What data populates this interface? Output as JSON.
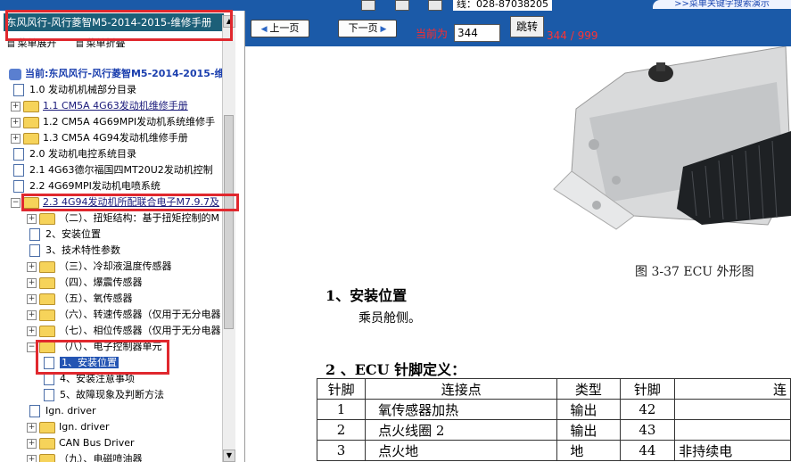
{
  "top": {
    "phone_text": "线：028-87038205",
    "link_text": ">>菜单关键字搜索演示"
  },
  "left": {
    "title": "东风风行-风行菱智M5-2014-2015-维修手册",
    "menu_expand": "菜单展开",
    "menu_collapse": "菜单折叠",
    "tree": [
      {
        "label": "当前:东风风行-风行菱智M5-2014-2015-维修",
        "kind": "root",
        "depth": 0
      },
      {
        "label": "1.0 发动机机械部分目录",
        "kind": "doc",
        "depth": 1
      },
      {
        "label": "1.1 CM5A 4G63发动机维修手册",
        "kind": "folder",
        "depth": 1,
        "link": true
      },
      {
        "label": "1.2 CM5A 4G69MPI发动机系统维修手",
        "kind": "folder",
        "depth": 1
      },
      {
        "label": "1.3 CM5A 4G94发动机维修手册",
        "kind": "folder",
        "depth": 1
      },
      {
        "label": "2.0 发动机电控系统目录",
        "kind": "doc",
        "depth": 1
      },
      {
        "label": "2.1 4G63德尔福国四MT20U2发动机控制",
        "kind": "doc",
        "depth": 1
      },
      {
        "label": "2.2 4G69MPI发动机电喷系统",
        "kind": "doc",
        "depth": 1
      },
      {
        "label": "2.3 4G94发动机所配联合电子M7.9.7及",
        "kind": "folder-open",
        "depth": 1,
        "link": true
      },
      {
        "label": "（二）、扭矩结构：基于扭矩控制的M",
        "kind": "folder",
        "depth": 2
      },
      {
        "label": "2、安装位置",
        "kind": "doc",
        "depth": 2
      },
      {
        "label": "3、技术特性参数",
        "kind": "doc",
        "depth": 2
      },
      {
        "label": "（三）、冷却液温度传感器",
        "kind": "folder",
        "depth": 2
      },
      {
        "label": "（四）、爆震传感器",
        "kind": "folder",
        "depth": 2
      },
      {
        "label": "（五）、氧传感器",
        "kind": "folder",
        "depth": 2
      },
      {
        "label": "（六）、转速传感器（仅用于无分电器",
        "kind": "folder",
        "depth": 2
      },
      {
        "label": "（七）、相位传感器（仅用于无分电器",
        "kind": "folder",
        "depth": 2
      },
      {
        "label": "（八）、电子控制器单元",
        "kind": "folder-open",
        "depth": 2
      },
      {
        "label": "1、安装位置",
        "kind": "doc",
        "depth": 3,
        "selected": true
      },
      {
        "label": "4、安装注意事项",
        "kind": "doc",
        "depth": 3
      },
      {
        "label": "5、故障现象及判断方法",
        "kind": "doc",
        "depth": 3
      },
      {
        "label": "Ign. driver",
        "kind": "doc",
        "depth": 2
      },
      {
        "label": "Ign. driver",
        "kind": "folder",
        "depth": 2
      },
      {
        "label": "CAN Bus Driver",
        "kind": "folder",
        "depth": 2
      },
      {
        "label": "（九）、电磁喷油器",
        "kind": "folder",
        "depth": 2
      }
    ]
  },
  "toolbar": {
    "prev_label": "上一页",
    "next_label": "下一页",
    "page_label": "当前为",
    "page_value": "344",
    "jump_label": "跳转",
    "page_count": "344 / 999"
  },
  "doc": {
    "figure_caption": "图 3-37    ECU 外形图",
    "heading1": "1、安装位置",
    "paragraph1": "乘员舱侧。",
    "heading2": "2 、ECU 针脚定义：",
    "table_headers": [
      "针脚",
      "连接点",
      "类型",
      "针脚",
      "连"
    ],
    "table_rows": [
      [
        "1",
        "氧传感器加热",
        "输出",
        "42",
        ""
      ],
      [
        "2",
        "点火线圈 2",
        "输出",
        "43",
        ""
      ],
      [
        "3",
        "点火地",
        "地",
        "44",
        "非持续电"
      ]
    ]
  }
}
